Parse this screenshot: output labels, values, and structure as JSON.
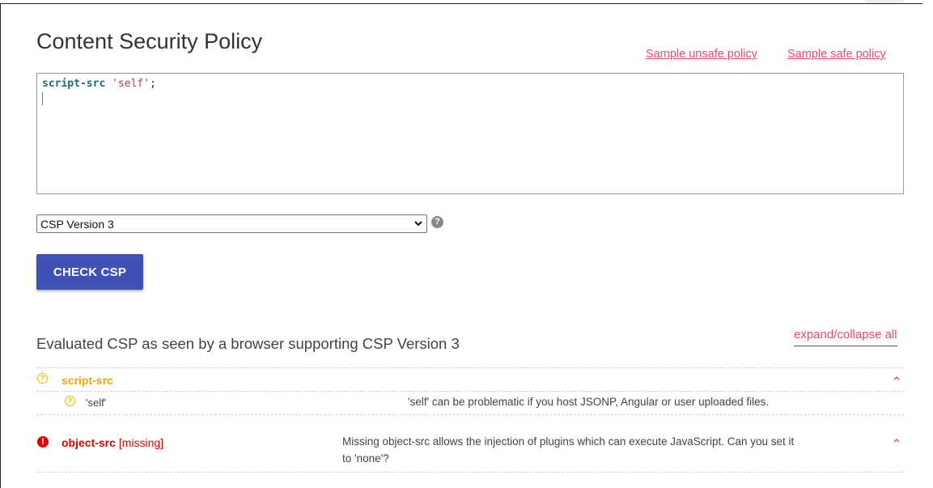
{
  "page": {
    "title": "Content Security Policy",
    "sample_unsafe_label": "Sample unsafe policy",
    "sample_safe_label": "Sample safe policy"
  },
  "editor": {
    "directive": "script-src",
    "value": "'self'",
    "terminator": ";"
  },
  "version_select": {
    "selected": "CSP Version 3",
    "help_glyph": "?"
  },
  "check_button_label": "CHECK CSP",
  "evaluation": {
    "heading": "Evaluated CSP as seen by a browser supporting CSP Version 3",
    "expand_collapse_label": "expand/collapse all",
    "directives": [
      {
        "name": "script-src",
        "severity": "warning",
        "icon": "question-circle-icon",
        "values": [
          {
            "value": "'self'",
            "finding": "'self' can be problematic if you host JSONP, Angular or user uploaded files."
          }
        ]
      },
      {
        "name": "object-src",
        "missing_tag": "[missing]",
        "severity": "error",
        "icon": "exclamation-circle-icon",
        "finding_line1": "Missing object-src allows the injection of plugins which can execute JavaScript. Can you set it",
        "finding_line2": "to 'none'?"
      }
    ]
  },
  "colors": {
    "link": "#e74c6e",
    "button": "#3f51b5",
    "warning": "#f0b400",
    "error": "#e00000"
  }
}
